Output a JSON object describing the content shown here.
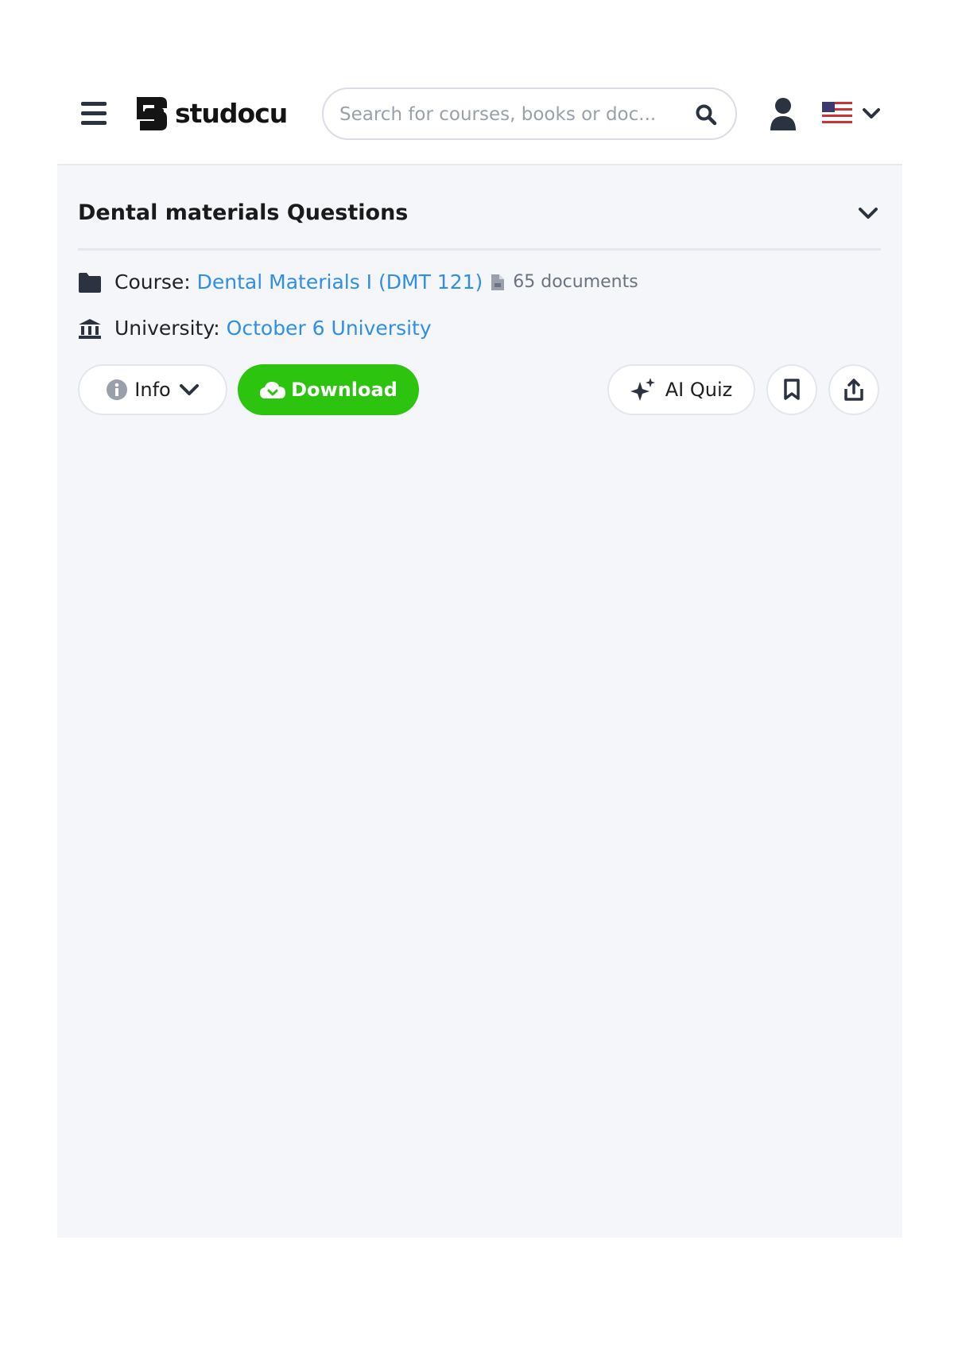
{
  "header": {
    "logo_text": "studocu",
    "search": {
      "placeholder": "Search for courses, books or doc...",
      "value": ""
    }
  },
  "document": {
    "title": "Dental materials Questions",
    "course_label": "Course:",
    "course_name": "Dental Materials I (DMT 121)",
    "document_count": "65 documents",
    "university_label": "University:",
    "university_name": "October 6 University"
  },
  "actions": {
    "info_label": "Info",
    "download_label": "Download",
    "ai_quiz_label": "AI Quiz"
  },
  "icons": [
    "menu-icon",
    "studocu-logo-icon",
    "search-icon",
    "user-icon",
    "us-flag-icon",
    "chevron-down-icon",
    "folder-icon",
    "file-icon",
    "university-icon",
    "info-icon",
    "cloud-download-icon",
    "sparkle-icon",
    "bookmark-icon",
    "share-icon"
  ],
  "colors": {
    "accent_link": "#2f8fe8",
    "download_green": "#2cc40f",
    "panel_background": "#f4f6fa",
    "icon_dark": "#2c3340"
  }
}
